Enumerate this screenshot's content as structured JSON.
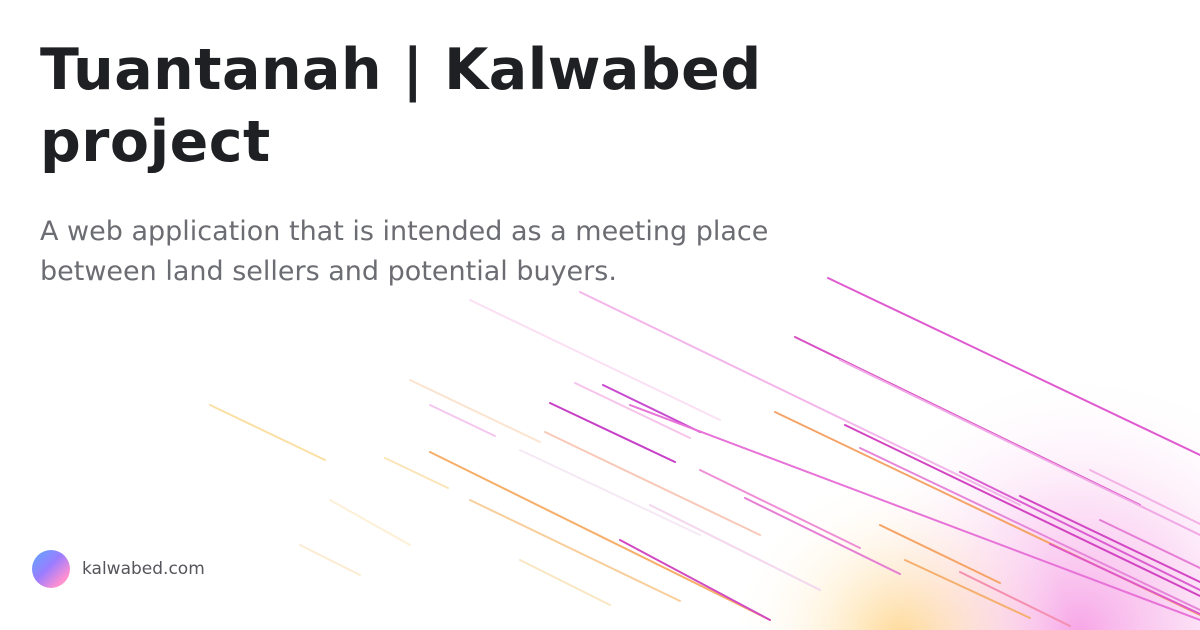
{
  "card": {
    "title": "Tuantanah | Kalwabed project",
    "description": "A web application that is intended as a meeting place between land sellers and potential buyers.",
    "site": {
      "label": "kalwabed.com",
      "icon": "kalwabed-logo-icon"
    }
  },
  "colors": {
    "title": "#1f2023",
    "description": "#6c6d73",
    "accent_pink": "#e040c0",
    "accent_orange": "#f5a040"
  }
}
